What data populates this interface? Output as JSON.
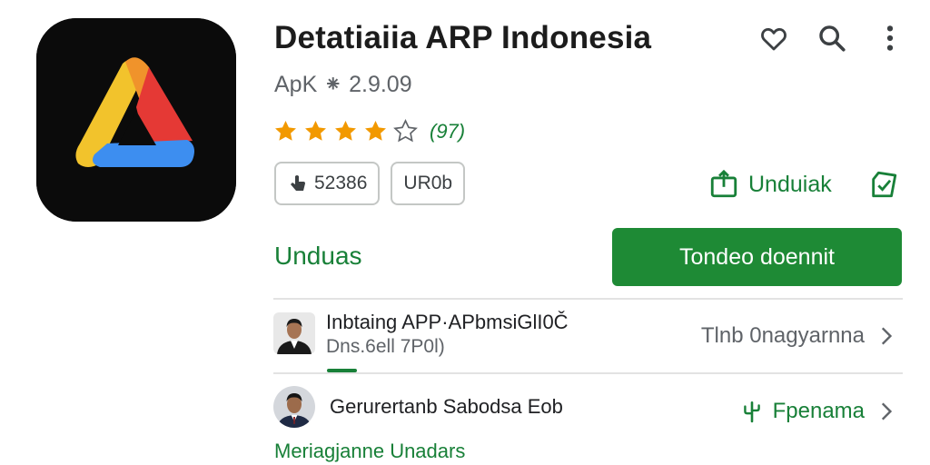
{
  "app": {
    "title": "Detatiaiia ARP Indonesia",
    "subtitle": "ApK ⁕ 2.9.09"
  },
  "rating": {
    "stars_filled": 4,
    "stars_total": 5,
    "count_label": "(97)"
  },
  "chips": [
    {
      "icon": "download-hand-icon",
      "label": "52386"
    },
    {
      "icon": "",
      "label": "UR0b"
    }
  ],
  "actions": {
    "download_label": "Unduiak",
    "install_button_label": "Tondeo doennit",
    "section_label": "Unduas"
  },
  "rows": [
    {
      "title": "Inbtaing APP·APbmsiGlI0Č",
      "subtitle": "Dns.6ell 7P0l)",
      "right_label": "Tlnb 0nagyarnna",
      "avatar": "person-avatar"
    },
    {
      "title": "Gerurertanb Sabodsa Eob",
      "subtitle": "",
      "right_label": "Fpenama",
      "right_icon": "cactus-icon",
      "avatar": "person-avatar"
    }
  ],
  "footer": {
    "link_label": "Meriagjanne Unadars"
  },
  "colors": {
    "accent_green": "#1e8a35",
    "star_orange": "#f29900",
    "text_primary": "#202124",
    "text_secondary": "#5f6368"
  }
}
